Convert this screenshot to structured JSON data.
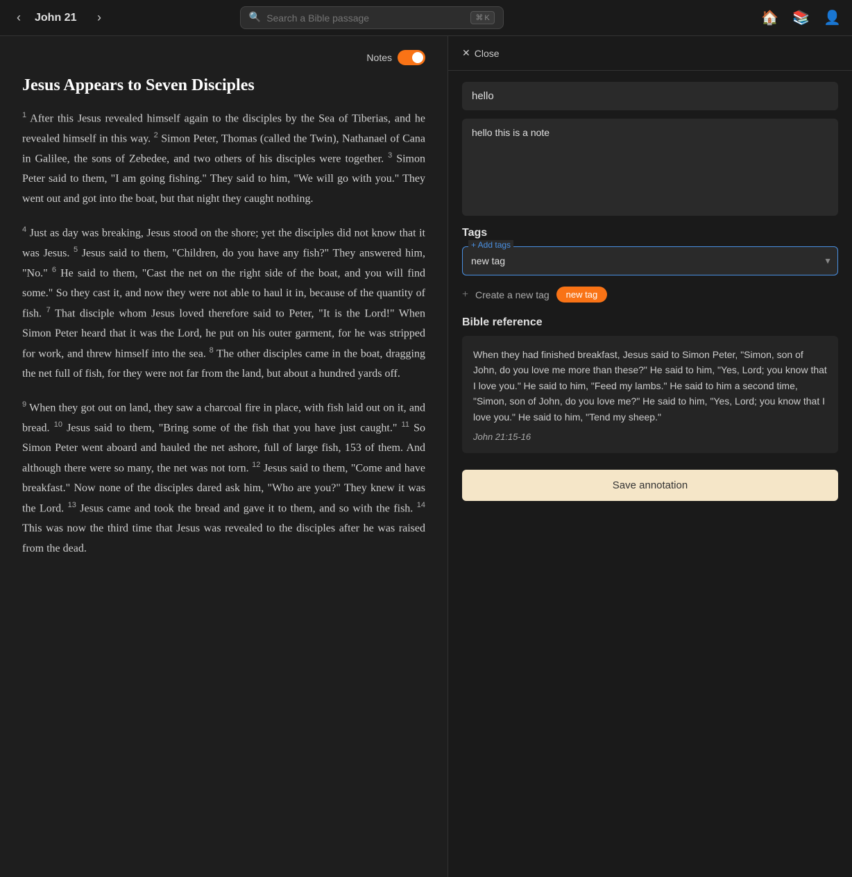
{
  "header": {
    "prev_label": "‹",
    "next_label": "›",
    "chapter": "John 21",
    "search_placeholder": "Search a Bible passage",
    "shortcut_cmd": "⌘",
    "shortcut_key": "K",
    "home_icon": "🏠",
    "books_icon": "📚",
    "user_icon": "👤"
  },
  "bible_panel": {
    "notes_label": "Notes",
    "chapter_title": "Jesus Appears to Seven Disciples",
    "verses": [
      {
        "num": "1",
        "text": "After this Jesus revealed himself again to the disciples by the Sea of Tiberias, and he revealed himself in this way."
      },
      {
        "num": "2",
        "text": "Simon Peter, Thomas (called the Twin), Nathanael of Cana in Galilee, the sons of Zebedee, and two others of his disciples were together."
      },
      {
        "num": "3",
        "text": "Simon Peter said to them, \"I am going fishing.\" They said to him, \"We will go with you.\" They went out and got into the boat, but that night they caught nothing."
      },
      {
        "num": "4",
        "text": "Just as day was breaking, Jesus stood on the shore; yet the disciples did not know that it was Jesus."
      },
      {
        "num": "5",
        "text": "Jesus said to them, \"Children, do you have any fish?\" They answered him, \"No.\""
      },
      {
        "num": "6",
        "text": "He said to them, \"Cast the net on the right side of the boat, and you will find some.\" So they cast it, and now they were not able to haul it in, because of the quantity of fish."
      },
      {
        "num": "7",
        "text": "That disciple whom Jesus loved therefore said to Peter, \"It is the Lord!\" When Simon Peter heard that it was the Lord, he put on his outer garment, for he was stripped for work, and threw himself into the sea."
      },
      {
        "num": "8",
        "text": "The other disciples came in the boat, dragging the net full of fish, for they were not far from the land, but about a hundred yards off."
      },
      {
        "num": "9",
        "text": "When they got out on land, they saw a charcoal fire in place, with fish laid out on it, and bread."
      },
      {
        "num": "10",
        "text": "Jesus said to them, \"Bring some of the fish that you have just caught.\""
      },
      {
        "num": "11",
        "text": "So Simon Peter went aboard and hauled the net ashore, full of large fish, 153 of them. And although there were so many, the net was not torn."
      },
      {
        "num": "12",
        "text": "Jesus said to them, \"Come and have breakfast.\" Now none of the disciples dared ask him, \"Who are you?\" They knew it was the Lord."
      },
      {
        "num": "13",
        "text": "Jesus came and took the bread and gave it to them, and so with the fish."
      },
      {
        "num": "14",
        "text": "This was now the third time that Jesus was revealed to the disciples after he was raised from the dead."
      }
    ]
  },
  "note_panel": {
    "close_label": "Close",
    "note_title": "hello",
    "note_body": "hello this is a note",
    "tags_label": "Tags",
    "add_tags_label": "+ Add tags",
    "tag_input_value": "new tag",
    "create_tag_label": "Create a new tag",
    "tag_pill_label": "new tag",
    "bible_ref_label": "Bible reference",
    "bible_ref_text": "When they had finished breakfast, Jesus said to Simon Peter, \"Simon, son of John, do you love me more than these?\" He said to him, \"Yes, Lord; you know that I love you.\" He said to him, \"Feed my lambs.\" He said to him a second time, \"Simon, son of John, do you love me?\" He said to him, \"Yes, Lord; you know that I love you.\" He said to him, \"Tend my sheep.\"",
    "bible_ref_citation": "John 21:15-16",
    "save_label": "Save annotation"
  }
}
